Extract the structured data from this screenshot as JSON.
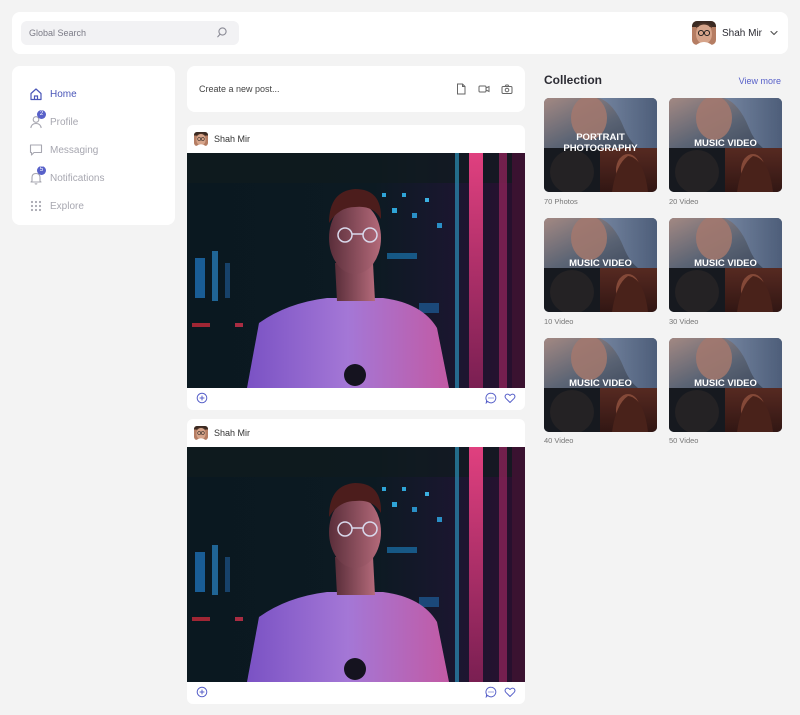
{
  "header": {
    "search_placeholder": "Global Search",
    "user_name": "Shah Mir"
  },
  "sidebar": {
    "items": [
      {
        "label": "Home",
        "icon": "home-icon",
        "active": true
      },
      {
        "label": "Profile",
        "icon": "user-icon",
        "badge": "2"
      },
      {
        "label": "Messaging",
        "icon": "chat-icon"
      },
      {
        "label": "Notifications",
        "icon": "bell-icon",
        "badge": "5"
      },
      {
        "label": "Explore",
        "icon": "grid-icon"
      }
    ]
  },
  "composer": {
    "placeholder": "Create a new post..."
  },
  "posts": [
    {
      "author": "Shah Mir"
    },
    {
      "author": "Shah Mir"
    }
  ],
  "collection": {
    "title": "Collection",
    "view_more": "View more",
    "cards": [
      {
        "title_line1": "PORTRAIT",
        "title_line2": "PHOTOGRAPHY",
        "caption": "70 Photos"
      },
      {
        "title_line1": "MUSIC VIDEO",
        "caption": "20 Video"
      },
      {
        "title_line1": "MUSIC VIDEO",
        "caption": "10 Video"
      },
      {
        "title_line1": "MUSIC VIDEO",
        "caption": "30 Video"
      },
      {
        "title_line1": "MUSIC VIDEO",
        "caption": "40 Video"
      },
      {
        "title_line1": "MUSIC VIDEO",
        "caption": "50 Video"
      }
    ]
  },
  "colors": {
    "accent": "#5861c9",
    "background": "#f3f3f3"
  }
}
